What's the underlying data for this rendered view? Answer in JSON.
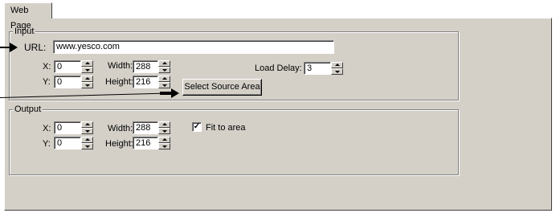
{
  "tab": {
    "label": "Web Page"
  },
  "input": {
    "group_title": "Input",
    "url_label": "URL:",
    "url_value": "www.yesco.com",
    "x_label": "X:",
    "x_value": "0",
    "y_label": "Y:",
    "y_value": "0",
    "width_label": "Width:",
    "width_value": "288",
    "height_label": "Height:",
    "height_value": "216",
    "load_delay_label": "Load Delay:",
    "load_delay_value": "3",
    "select_button": "Select Source Area"
  },
  "output": {
    "group_title": "Output",
    "x_label": "X:",
    "x_value": "0",
    "y_label": "Y:",
    "y_value": "0",
    "width_label": "Width:",
    "width_value": "288",
    "height_label": "Height:",
    "height_value": "216",
    "fit_label": "Fit to area",
    "fit_checked": "✓"
  }
}
